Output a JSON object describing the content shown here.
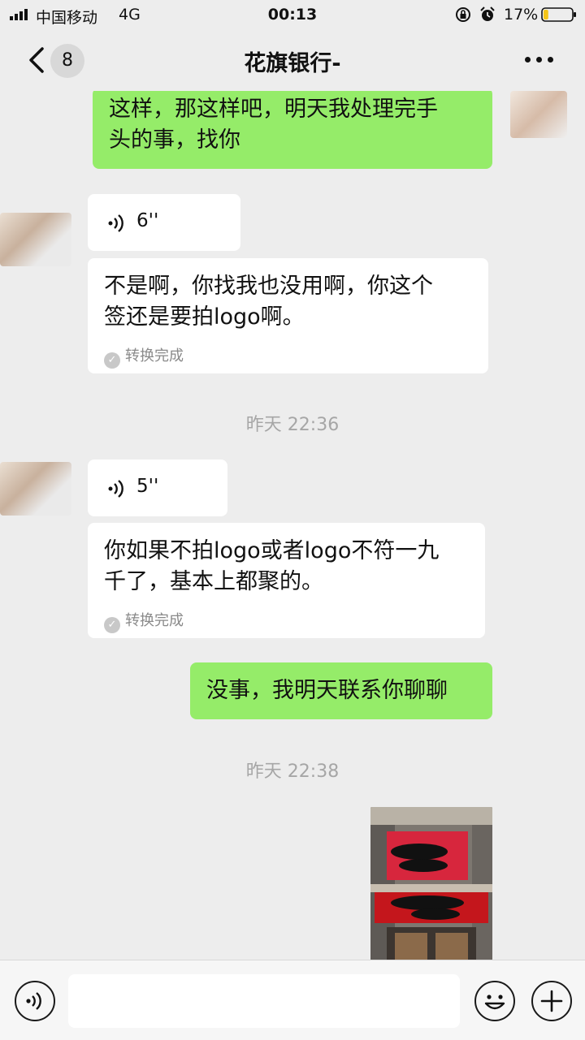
{
  "status_bar": {
    "carrier": "中国移动",
    "network": "4G",
    "time": "00:13",
    "battery_percent": "17%",
    "battery_level": 0.17,
    "battery_color": "#f5c518",
    "icons": [
      "signal-bars-icon",
      "rotation-lock-icon",
      "alarm-clock-icon",
      "battery-icon"
    ]
  },
  "nav": {
    "back_label": "8",
    "title": "花旗银行-",
    "icons": [
      "chevron-left-icon",
      "more-dots-icon"
    ]
  },
  "messages": [
    {
      "type": "text",
      "side": "out",
      "lines": [
        "这样，那这样吧，明天我处理完手",
        "头的事，找你"
      ]
    },
    {
      "type": "voice",
      "side": "in",
      "duration": "6''"
    },
    {
      "type": "transcript",
      "side": "in",
      "lines": [
        "不是啊，你找我也没用啊，你这个",
        "签还是要拍logo啊。"
      ],
      "status": "转换完成"
    },
    {
      "type": "timestamp",
      "text": "昨天 22:36"
    },
    {
      "type": "voice",
      "side": "in",
      "duration": "5''"
    },
    {
      "type": "transcript",
      "side": "in",
      "lines": [
        "你如果不拍logo或者logo不符一九",
        "千了，基本上都聚的。"
      ],
      "status": "转换完成"
    },
    {
      "type": "text",
      "side": "out",
      "lines": [
        "没事，我明天联系你聊聊"
      ]
    },
    {
      "type": "timestamp",
      "text": "昨天 22:38"
    },
    {
      "type": "image",
      "side": "out"
    }
  ],
  "input_bar": {
    "placeholder": "",
    "icons": [
      "voice-input-icon",
      "emoji-icon",
      "plus-icon"
    ]
  },
  "colors": {
    "outgoing_bubble": "#95ec69",
    "incoming_bubble": "#ffffff",
    "background": "#ededed"
  }
}
